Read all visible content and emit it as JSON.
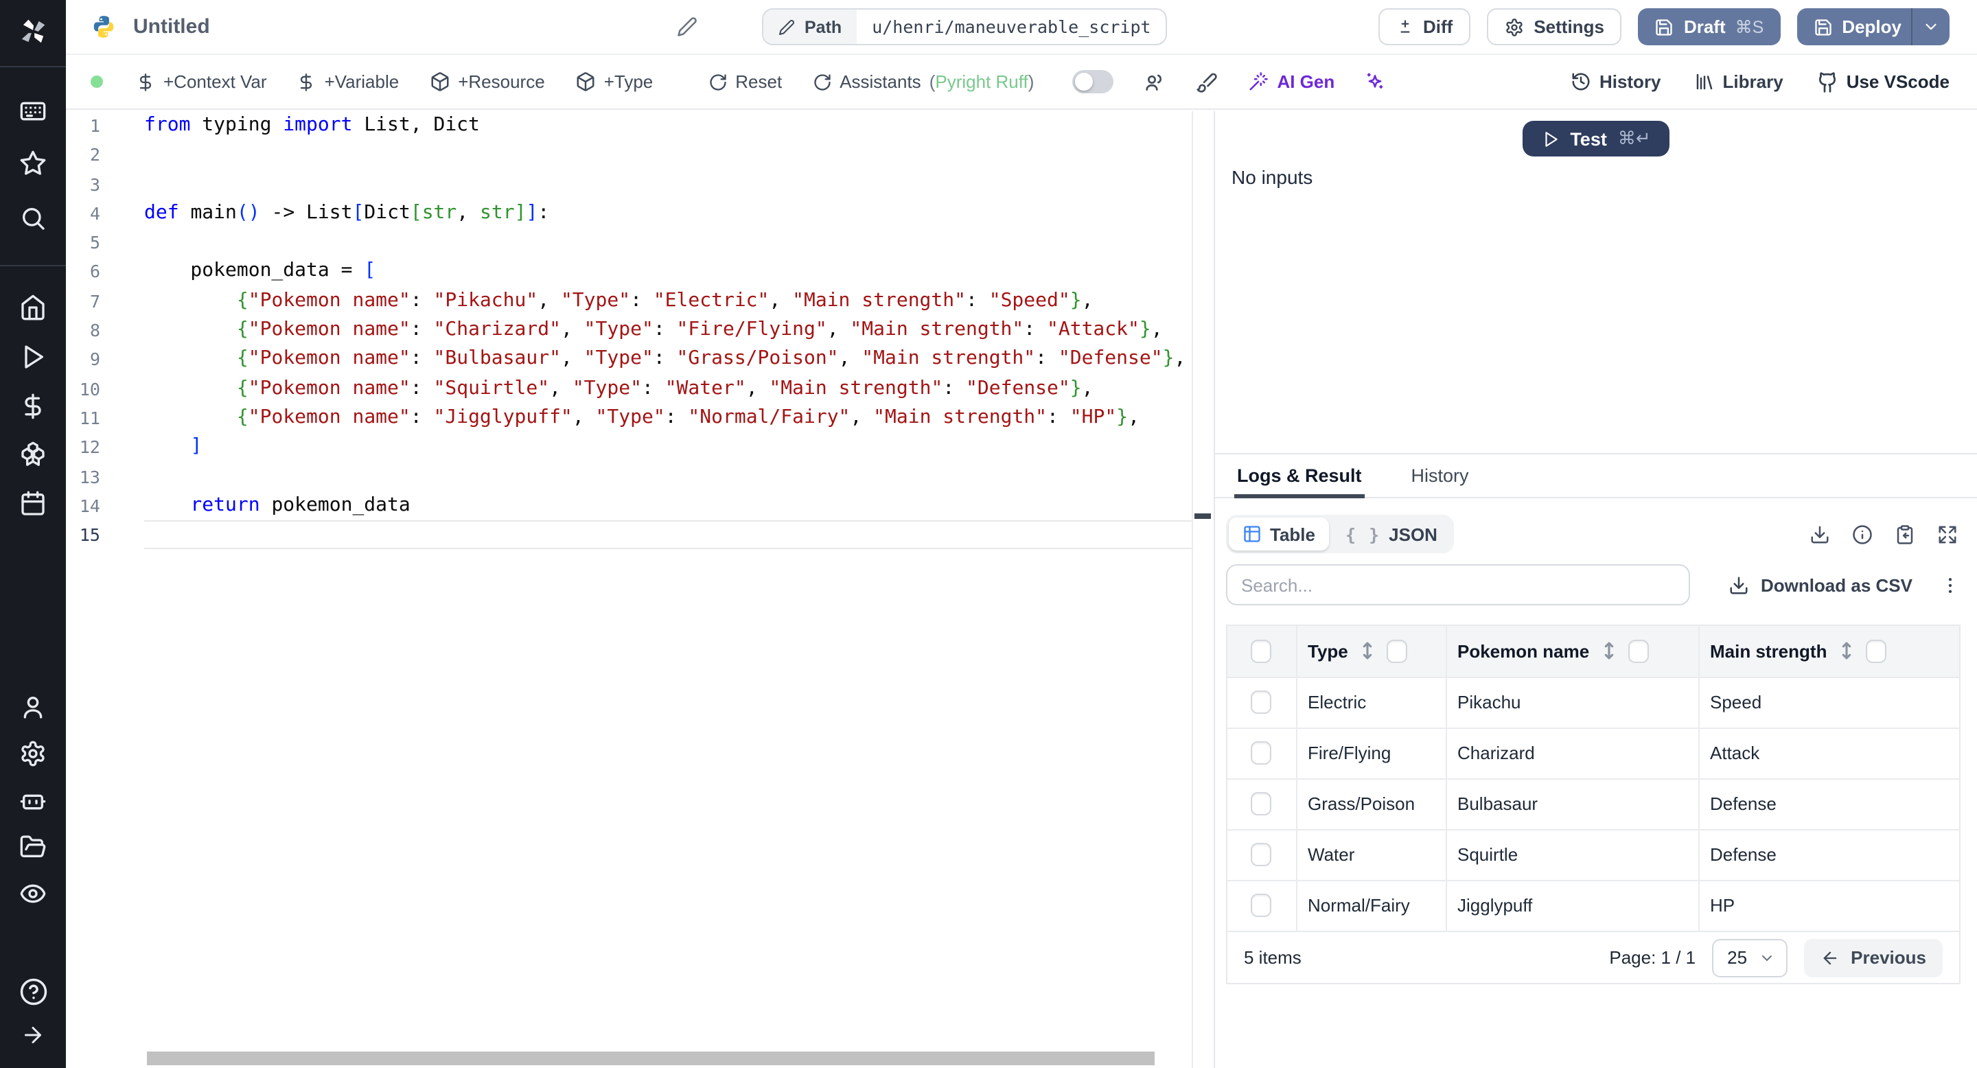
{
  "topbar": {
    "title": "Untitled",
    "path_label": "Path",
    "path_value": "u/henri/maneuverable_script",
    "buttons": {
      "diff": "Diff",
      "settings": "Settings",
      "draft": "Draft",
      "draft_shortcut": "⌘S",
      "deploy": "Deploy"
    }
  },
  "toolbar": {
    "context_var": "+Context Var",
    "variable": "+Variable",
    "resource": "+Resource",
    "type": "+Type",
    "reset": "Reset",
    "assistants": "Assistants",
    "assistants_detail": {
      "open": "(",
      "name": "Pyright Ruff",
      "close": ")"
    },
    "ai_gen": "AI Gen",
    "history": "History",
    "library": "Library",
    "use_vscode": "Use VScode"
  },
  "run": {
    "test_label": "Test",
    "test_shortcut": "⌘↵",
    "no_inputs": "No inputs"
  },
  "editor": {
    "lines": [
      {
        "n": 1,
        "t": [
          [
            "k",
            "from"
          ],
          [
            "tx",
            " typing "
          ],
          [
            "k",
            "import"
          ],
          [
            "tx",
            " List, Dict"
          ]
        ]
      },
      {
        "n": 2,
        "t": []
      },
      {
        "n": 3,
        "t": []
      },
      {
        "n": 4,
        "t": [
          [
            "k",
            "def"
          ],
          [
            "tx",
            " main"
          ],
          [
            "p1",
            "()"
          ],
          [
            "tx",
            " -> List"
          ],
          [
            "p1",
            "["
          ],
          [
            "tx",
            "Dict"
          ],
          [
            "p2",
            "["
          ],
          [
            "ty",
            "str"
          ],
          [
            "tx",
            ", "
          ],
          [
            "ty",
            "str"
          ],
          [
            "p2",
            "]"
          ],
          [
            "p1",
            "]"
          ],
          [
            "tx",
            ":"
          ]
        ]
      },
      {
        "n": 5,
        "t": []
      },
      {
        "n": 6,
        "t": [
          [
            "tx",
            "    pokemon_data = "
          ],
          [
            "p1",
            "["
          ]
        ]
      },
      {
        "n": 7,
        "t": [
          [
            "tx",
            "        "
          ],
          [
            "p2",
            "{"
          ],
          [
            "s",
            "\"Pokemon name\""
          ],
          [
            "tx",
            ": "
          ],
          [
            "s",
            "\"Pikachu\""
          ],
          [
            "tx",
            ", "
          ],
          [
            "s",
            "\"Type\""
          ],
          [
            "tx",
            ": "
          ],
          [
            "s",
            "\"Electric\""
          ],
          [
            "tx",
            ", "
          ],
          [
            "s",
            "\"Main strength\""
          ],
          [
            "tx",
            ": "
          ],
          [
            "s",
            "\"Speed\""
          ],
          [
            "p2",
            "}"
          ],
          [
            "tx",
            ","
          ]
        ]
      },
      {
        "n": 8,
        "t": [
          [
            "tx",
            "        "
          ],
          [
            "p2",
            "{"
          ],
          [
            "s",
            "\"Pokemon name\""
          ],
          [
            "tx",
            ": "
          ],
          [
            "s",
            "\"Charizard\""
          ],
          [
            "tx",
            ", "
          ],
          [
            "s",
            "\"Type\""
          ],
          [
            "tx",
            ": "
          ],
          [
            "s",
            "\"Fire/Flying\""
          ],
          [
            "tx",
            ", "
          ],
          [
            "s",
            "\"Main strength\""
          ],
          [
            "tx",
            ": "
          ],
          [
            "s",
            "\"Attack\""
          ],
          [
            "p2",
            "}"
          ],
          [
            "tx",
            ","
          ]
        ]
      },
      {
        "n": 9,
        "t": [
          [
            "tx",
            "        "
          ],
          [
            "p2",
            "{"
          ],
          [
            "s",
            "\"Pokemon name\""
          ],
          [
            "tx",
            ": "
          ],
          [
            "s",
            "\"Bulbasaur\""
          ],
          [
            "tx",
            ", "
          ],
          [
            "s",
            "\"Type\""
          ],
          [
            "tx",
            ": "
          ],
          [
            "s",
            "\"Grass/Poison\""
          ],
          [
            "tx",
            ", "
          ],
          [
            "s",
            "\"Main strength\""
          ],
          [
            "tx",
            ": "
          ],
          [
            "s",
            "\"Defense\""
          ],
          [
            "p2",
            "}"
          ],
          [
            "tx",
            ","
          ]
        ]
      },
      {
        "n": 10,
        "t": [
          [
            "tx",
            "        "
          ],
          [
            "p2",
            "{"
          ],
          [
            "s",
            "\"Pokemon name\""
          ],
          [
            "tx",
            ": "
          ],
          [
            "s",
            "\"Squirtle\""
          ],
          [
            "tx",
            ", "
          ],
          [
            "s",
            "\"Type\""
          ],
          [
            "tx",
            ": "
          ],
          [
            "s",
            "\"Water\""
          ],
          [
            "tx",
            ", "
          ],
          [
            "s",
            "\"Main strength\""
          ],
          [
            "tx",
            ": "
          ],
          [
            "s",
            "\"Defense\""
          ],
          [
            "p2",
            "}"
          ],
          [
            "tx",
            ","
          ]
        ]
      },
      {
        "n": 11,
        "t": [
          [
            "tx",
            "        "
          ],
          [
            "p2",
            "{"
          ],
          [
            "s",
            "\"Pokemon name\""
          ],
          [
            "tx",
            ": "
          ],
          [
            "s",
            "\"Jigglypuff\""
          ],
          [
            "tx",
            ", "
          ],
          [
            "s",
            "\"Type\""
          ],
          [
            "tx",
            ": "
          ],
          [
            "s",
            "\"Normal/Fairy\""
          ],
          [
            "tx",
            ", "
          ],
          [
            "s",
            "\"Main strength\""
          ],
          [
            "tx",
            ": "
          ],
          [
            "s",
            "\"HP\""
          ],
          [
            "p2",
            "}"
          ],
          [
            "tx",
            ","
          ]
        ]
      },
      {
        "n": 12,
        "t": [
          [
            "tx",
            "    "
          ],
          [
            "p1",
            "]"
          ]
        ]
      },
      {
        "n": 13,
        "t": []
      },
      {
        "n": 14,
        "t": [
          [
            "tx",
            "    "
          ],
          [
            "k",
            "return"
          ],
          [
            "tx",
            " pokemon_data"
          ]
        ]
      },
      {
        "n": 15,
        "t": [],
        "active": true
      }
    ]
  },
  "result": {
    "tabs": [
      "Logs & Result",
      "History"
    ],
    "views": {
      "table": "Table",
      "json": "JSON",
      "json_icon": "{ }"
    },
    "search_placeholder": "Search...",
    "download_csv": "Download as CSV",
    "table": {
      "columns": [
        "Type",
        "Pokemon name",
        "Main strength"
      ],
      "rows": [
        [
          "Electric",
          "Pikachu",
          "Speed"
        ],
        [
          "Fire/Flying",
          "Charizard",
          "Attack"
        ],
        [
          "Grass/Poison",
          "Bulbasaur",
          "Defense"
        ],
        [
          "Water",
          "Squirtle",
          "Defense"
        ],
        [
          "Normal/Fairy",
          "Jigglypuff",
          "HP"
        ]
      ],
      "footer": {
        "items": "5 items",
        "page": "Page: 1 / 1",
        "page_size": "25",
        "previous": "Previous"
      }
    }
  },
  "colors": {
    "accent-slate": "#64789f",
    "accent-navy": "#2f3d5e",
    "purple": "#6d28d9",
    "green-dot": "#86df97",
    "green-text": "#79c98c",
    "table-blue": "#3b82f6",
    "sidebar-bg": "#181b21",
    "kw": "#0000ff",
    "str": "#a31515",
    "type": "#319331",
    "br1": "#0431fa",
    "br2": "#319331"
  }
}
